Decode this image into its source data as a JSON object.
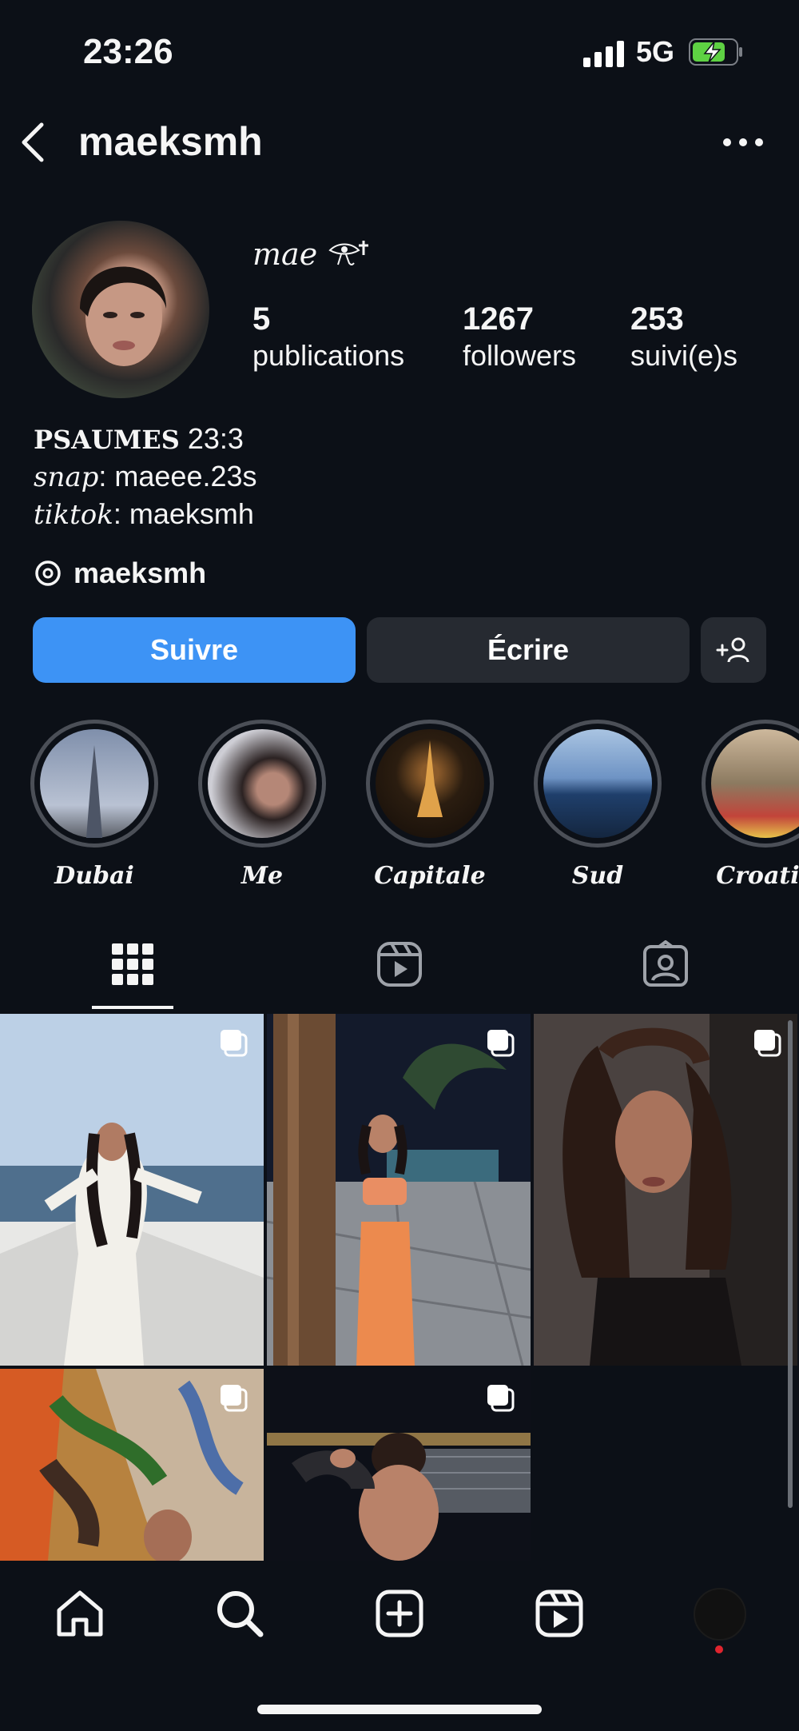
{
  "status_bar": {
    "time": "23:26",
    "network": "5G"
  },
  "header": {
    "username": "maeksmh"
  },
  "profile": {
    "display_name": "mae",
    "stats": [
      {
        "value": "5",
        "label": "publications"
      },
      {
        "value": "1267",
        "label": "followers"
      },
      {
        "value": "253",
        "label": "suivi(e)s"
      }
    ],
    "bio": {
      "line1_bold": "PSAUMES",
      "line1_rest": " 23:3",
      "line2_key": "snap",
      "line2_rest": ": maeee.23s",
      "line3_key": "tiktok",
      "line3_rest": ": maeksmh"
    },
    "threads_handle": "maeksmh"
  },
  "actions": {
    "follow_label": "Suivre",
    "message_label": "Écrire"
  },
  "highlights": [
    {
      "label": "Dubai"
    },
    {
      "label": "Me"
    },
    {
      "label": "Capitale"
    },
    {
      "label": "Sud"
    },
    {
      "label": "Croatie"
    }
  ],
  "colors": {
    "background": "#0c1017",
    "accent": "#3d93f5",
    "button_dark": "#262a31",
    "notification_dot": "#e0242e"
  },
  "icons": {
    "tabs": [
      "grid-icon",
      "reels-icon",
      "tagged-icon"
    ],
    "nav": [
      "home-icon",
      "search-icon",
      "create-icon",
      "reels-icon",
      "profile-avatar"
    ]
  }
}
